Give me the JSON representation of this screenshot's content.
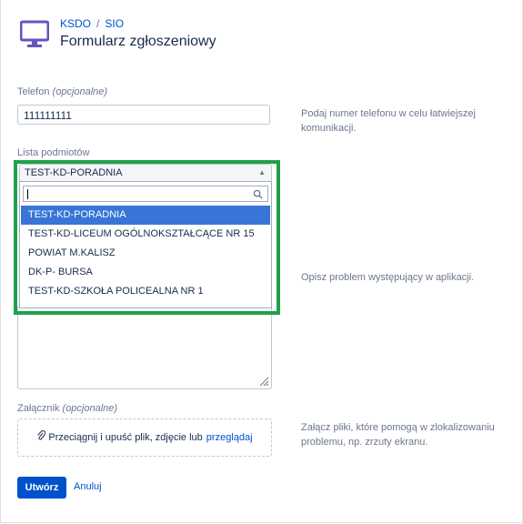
{
  "header": {
    "breadcrumb": [
      "KSDO",
      "SIO"
    ],
    "breadcrumb_separator": "/",
    "title": "Formularz zgłoszeniowy",
    "icon": "monitor-icon"
  },
  "phone": {
    "label": "Telefon",
    "optional": "(opcjonalne)",
    "value": "111111111",
    "help": "Podaj numer telefonu w celu łatwiejszej komunikacji."
  },
  "entities": {
    "label": "Lista podmiotów",
    "selected": "TEST-KD-PORADNIA",
    "search_value": "",
    "options": [
      "TEST-KD-PORADNIA",
      "TEST-KD-LICEUM OGÓLNOKSZTAŁCĄCE NR 15",
      "POWIAT M.KALISZ",
      "DK-P- BURSA",
      "TEST-KD-SZKOŁA POLICEALNA NR 1"
    ],
    "highlighted_index": 0
  },
  "description": {
    "help": "Opisz problem występujący w aplikacji."
  },
  "attachment": {
    "label": "Załącznik",
    "optional": "(opcjonalne)",
    "drop_text": "Przeciągnij i upuść plik, zdjęcie lub",
    "browse": "przeglądaj",
    "help": "Załącz pliki, które pomogą w zlokalizowaniu problemu, np. zrzuty ekranu."
  },
  "actions": {
    "submit": "Utwórz",
    "cancel": "Anuluj"
  },
  "colors": {
    "accent": "#0052cc",
    "highlight_border": "#1fa14a",
    "selected_option": "#3875d7",
    "icon_purple": "#6554c0"
  }
}
